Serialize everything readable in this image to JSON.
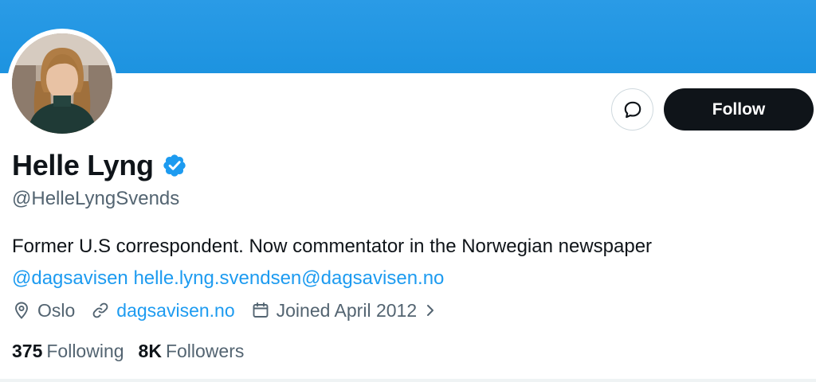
{
  "profile": {
    "display_name": "Helle Lyng",
    "handle": "@HelleLyngSvends",
    "verified": true,
    "bio_text": "Former U.S correspondent. Now commentator in the Norwegian newspaper",
    "bio_mention": "@dagsavisen",
    "bio_email": "helle.lyng.svendsen@dagsavisen.no",
    "location": "Oslo",
    "website": "dagsavisen.no",
    "joined": "Joined April 2012",
    "following_count": "375",
    "following_label": "Following",
    "followers_count": "8K",
    "followers_label": "Followers"
  },
  "actions": {
    "follow_label": "Follow",
    "message_icon": "message-bubble-icon"
  },
  "colors": {
    "banner": "#1d93e0",
    "link": "#1d9bf0",
    "secondary_text": "#536471",
    "follow_button": "#0f1419"
  }
}
